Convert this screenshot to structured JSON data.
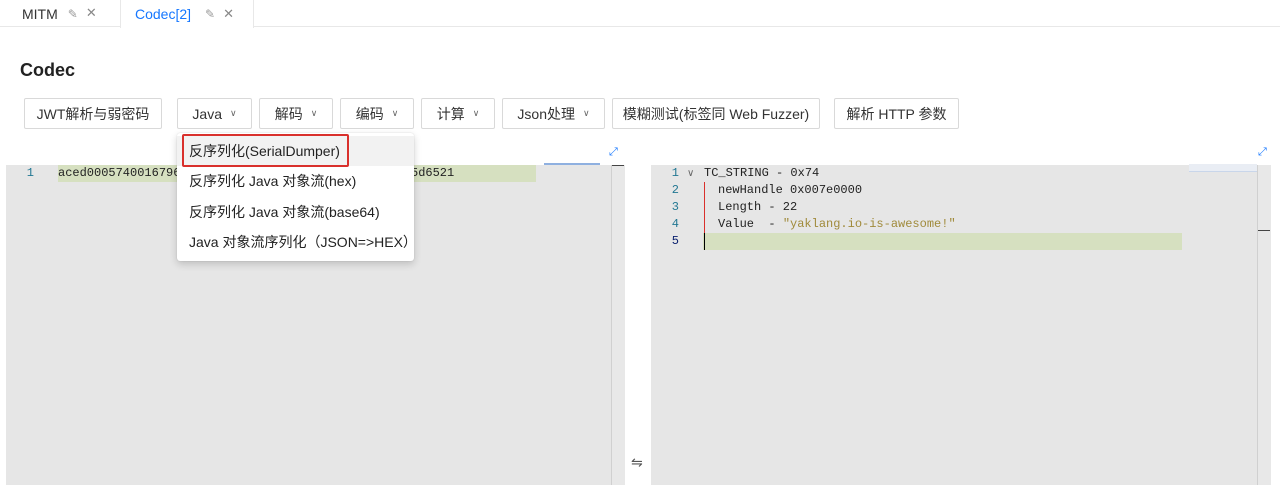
{
  "tabs": [
    {
      "label": "MITM"
    },
    {
      "label": "Codec[2]"
    }
  ],
  "page_title": "Codec",
  "toolbar": {
    "jwt": "JWT解析与弱密码",
    "java": "Java",
    "decode": "解码",
    "encode": "编码",
    "compute": "计算",
    "json": "Json处理",
    "fuzz": "模糊测试(标签同 Web Fuzzer)",
    "http": "解析 HTTP 参数"
  },
  "dropdown": {
    "items": [
      {
        "label": "反序列化(SerialDumper)"
      },
      {
        "label": "反序列化 Java 对象流(hex)"
      },
      {
        "label": "反序列化 Java 对象流(base64)"
      },
      {
        "label": "Java 对象流序列化（JSON=>HEX）"
      }
    ]
  },
  "left_editor": {
    "line_number": "1",
    "text_start": "aced00057400167961",
    "text_end": "5d6521"
  },
  "right_editor": {
    "lines": [
      {
        "n": "1",
        "text": "TC_STRING - 0x74"
      },
      {
        "n": "2",
        "text": "newHandle 0x007e0000"
      },
      {
        "n": "3",
        "text": "Length - 22"
      },
      {
        "n": "4",
        "key": "Value  - ",
        "str": "\"yaklang.io-is-awesome!\""
      },
      {
        "n": "5",
        "text": ""
      }
    ]
  },
  "icons": {
    "edit": "✎",
    "close": "✕",
    "chevron": "∨",
    "expand": "⤢",
    "fold": "∨",
    "swap": "⇋"
  }
}
